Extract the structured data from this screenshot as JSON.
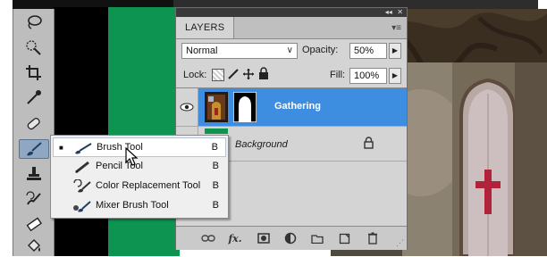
{
  "toolbar": {
    "tools": [
      {
        "name": "lasso-tool-icon"
      },
      {
        "name": "quick-selection-tool-icon"
      },
      {
        "name": "crop-tool-icon"
      },
      {
        "name": "eyedropper-tool-icon"
      },
      {
        "name": "spot-healing-brush-tool-icon"
      },
      {
        "name": "brush-tool-icon",
        "active": true
      },
      {
        "name": "clone-stamp-tool-icon"
      },
      {
        "name": "history-brush-tool-icon"
      },
      {
        "name": "eraser-tool-icon"
      },
      {
        "name": "paint-bucket-tool-icon"
      }
    ]
  },
  "layers_panel": {
    "title": "LAYERS",
    "collapse_glyph": "◂◂",
    "close_glyph": "✕",
    "blend_mode": "Normal",
    "opacity_label": "Opacity:",
    "opacity_value": "50%",
    "lock_label": "Lock:",
    "fill_label": "Fill:",
    "fill_value": "100%",
    "layers": [
      {
        "name": "Gathering",
        "selected": true,
        "visible": true
      },
      {
        "name": "Background",
        "selected": false,
        "visible": false,
        "locked": true
      }
    ]
  },
  "tool_flyout": {
    "items": [
      {
        "label": "Brush Tool",
        "shortcut": "B",
        "current": true,
        "icon": "brush-icon"
      },
      {
        "label": "Pencil Tool",
        "shortcut": "B",
        "current": false,
        "icon": "pencil-icon"
      },
      {
        "label": "Color Replacement Tool",
        "shortcut": "B",
        "current": false,
        "icon": "color-replacement-icon"
      },
      {
        "label": "Mixer Brush Tool",
        "shortcut": "B",
        "current": false,
        "icon": "mixer-brush-icon"
      }
    ]
  },
  "colors": {
    "selected_layer": "#3d8ee0",
    "toolbar_bg": "#bdbdbd",
    "panel_bg": "#d4d4d4",
    "canvas_green": "#0c9450"
  }
}
